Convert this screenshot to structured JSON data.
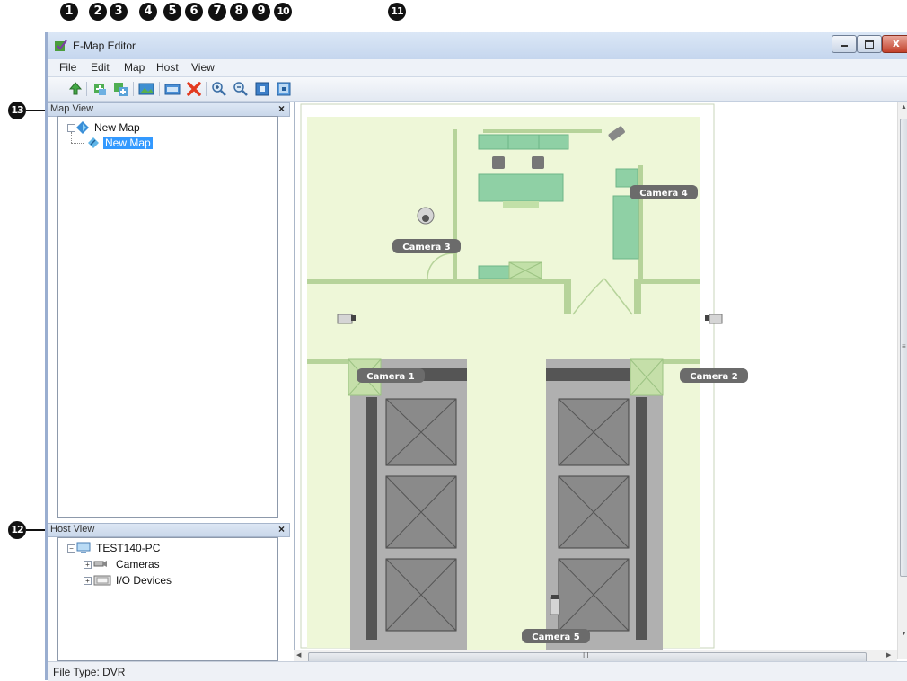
{
  "window": {
    "title": "E-Map Editor"
  },
  "menu": [
    "File",
    "Edit",
    "Map",
    "Host",
    "View"
  ],
  "callouts": [
    "1",
    "2",
    "3",
    "4",
    "5",
    "6",
    "7",
    "8",
    "9",
    "10",
    "11",
    "12",
    "13"
  ],
  "map_view": {
    "title": "Map View",
    "close": "×",
    "tree": {
      "root": "New Map",
      "child": "New Map"
    }
  },
  "host_view": {
    "title": "Host View",
    "close": "×",
    "tree": {
      "root": "TEST140-PC",
      "cameras": "Cameras",
      "io": "I/O Devices"
    }
  },
  "cameras": [
    "Camera 1",
    "Camera 2",
    "Camera 3",
    "Camera 4",
    "Camera 5"
  ],
  "status": "File Type: DVR",
  "scrollbar_marker": "III",
  "colors": {
    "floor": "#eef7d8",
    "wall": "#b6d39a",
    "furniture": "#8fd0a5",
    "elevator": "#8a8a8a",
    "label": "#6b6b6b"
  }
}
